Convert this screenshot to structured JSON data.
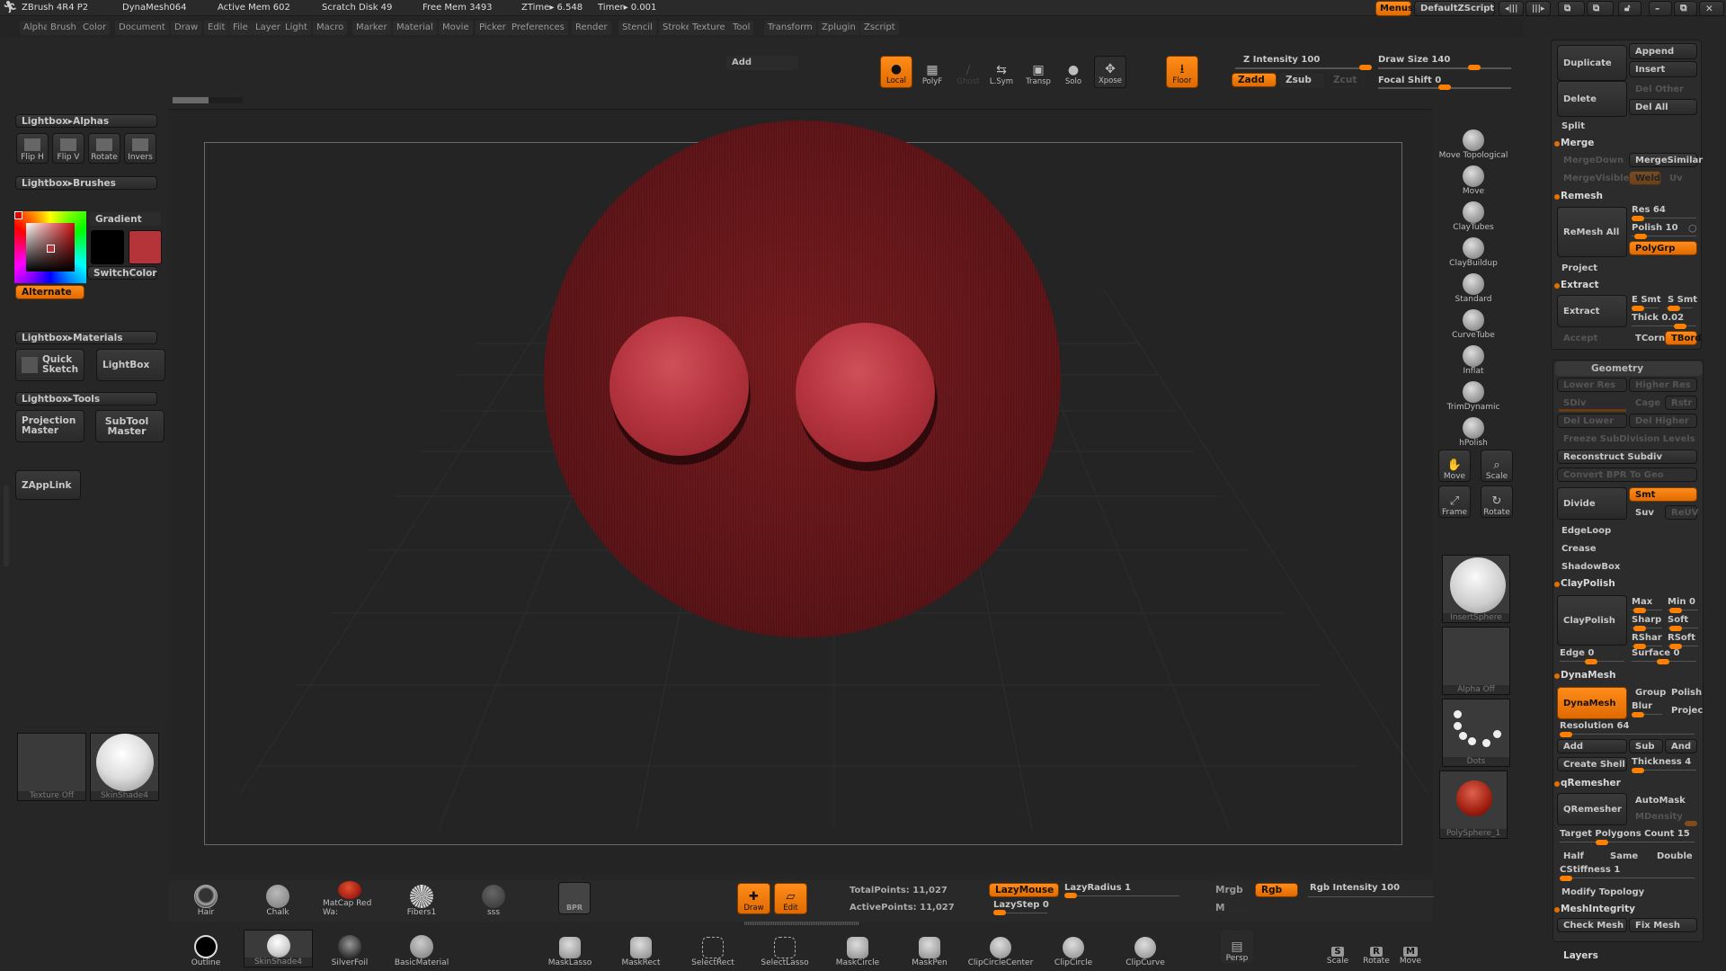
{
  "titlebar": {
    "app": "ZBrush 4R4 P2",
    "document": "DynaMesh064",
    "active_mem": "Active Mem 602",
    "scratch_disk": "Scratch Disk 49",
    "free_mem": "Free Mem 3493",
    "ztime": "ZTime▸ 6.548",
    "timer": "Timer▸ 0.001",
    "menus_button": "Menus",
    "script_button": "DefaultZScript"
  },
  "menubar": [
    "Alpha",
    "Brush",
    "Color",
    "Document",
    "Draw",
    "Edit",
    "File",
    "Layer",
    "Light",
    "Macro",
    "Marker",
    "Material",
    "Movie",
    "Picker",
    "Preferences",
    "Render",
    "Stencil",
    "Stroke",
    "Texture",
    "Tool",
    "Transform",
    "Zplugin",
    "Zscript"
  ],
  "top_toolbar": {
    "mode_field": "Add",
    "buttons": [
      {
        "id": "local",
        "label": "Local",
        "active": true
      },
      {
        "id": "polyf",
        "label": "PolyF",
        "active": false
      },
      {
        "id": "ghost",
        "label": "Ghost",
        "active": false,
        "disabled": true
      },
      {
        "id": "lsym",
        "label": "L.Sym",
        "active": false
      },
      {
        "id": "transp",
        "label": "Transp",
        "active": false
      },
      {
        "id": "solo",
        "label": "Solo",
        "active": false
      },
      {
        "id": "xpose",
        "label": "Xpose",
        "active": false
      },
      {
        "id": "floor",
        "label": "Floor",
        "active": true
      }
    ],
    "z_intensity": {
      "label": "Z Intensity",
      "value": "100",
      "fraction": 1.0
    },
    "draw_size": {
      "label": "Draw Size",
      "value": "140",
      "fraction": 0.7
    },
    "focal_shift": {
      "label": "Focal Shift",
      "value": "0",
      "fraction": 0.5
    },
    "zadd": "Zadd",
    "zsub": "Zsub",
    "zcut": "Zcut"
  },
  "left_panel": {
    "lightbox_alphas": "Lightbox▸Alphas",
    "alpha_buttons": [
      "Flip H",
      "Flip V",
      "Rotate",
      "Invers"
    ],
    "lightbox_brushes": "Lightbox▸Brushes",
    "gradient": "Gradient",
    "switch_color": "SwitchColor",
    "alternate": "Alternate",
    "main_color": "#b5343a",
    "secondary_color": "#000000",
    "lightbox_materials": "Lightbox▸Materials",
    "quick_sketch": "Quick Sketch",
    "lightbox": "LightBox",
    "lightbox_tools": "Lightbox▸Tools",
    "projection_master": "Projection Master",
    "subtool_master": "SubTool Master",
    "zapplink": "ZAppLink",
    "texture_thumb": "Texture Off",
    "material_thumb": "SkinShade4"
  },
  "right_shelf": {
    "brushes": [
      "Move Topological",
      "Move",
      "ClayTubes",
      "ClayBuildup",
      "Standard",
      "CurveTube",
      "Inflat",
      "TrimDynamic",
      "hPolish"
    ],
    "nav": [
      "Move",
      "Scale",
      "Frame",
      "Rotate"
    ],
    "thumbs": [
      "InsertSphere",
      "Alpha Off",
      "Dots",
      "PolySphere_1"
    ]
  },
  "tool_panel": {
    "duplicate": "Duplicate",
    "append": "Append",
    "insert": "Insert",
    "delete": "Delete",
    "del_other": "Del Other",
    "del_all": "Del All",
    "split": "Split",
    "merge": "Merge",
    "merge_down": "MergeDown",
    "merge_similar": "MergeSimilar",
    "merge_visible": "MergeVisible",
    "weld": "Weld",
    "uv": "Uv",
    "remesh": "Remesh",
    "remesh_all": "ReMesh All",
    "res": "Res 64",
    "polish": "Polish 10",
    "polygrp": "PolyGrp",
    "project": "Project",
    "extract": "Extract",
    "extract_btn": "Extract",
    "e_smt": "E Smt",
    "s_smt": "S Smt",
    "thick": "Thick 0.02",
    "accept": "Accept",
    "tcorn": "TCorn",
    "tbord": "TBord",
    "geometry": "Geometry",
    "lower_res": "Lower Res",
    "higher_res": "Higher Res",
    "sdiv": "SDiv",
    "cage": "Cage",
    "rstr": "Rstr",
    "del_lower": "Del Lower",
    "del_higher": "Del Higher",
    "freeze": "Freeze SubDivision Levels",
    "reconstruct": "Reconstruct Subdiv",
    "convert_bpr": "Convert BPR To Geo",
    "divide": "Divide",
    "smt": "Smt",
    "suv": "Suv",
    "reuv": "ReUV",
    "edgeloop": "EdgeLoop",
    "crease": "Crease",
    "shadowbox": "ShadowBox",
    "claypolish": "ClayPolish",
    "claypolish_btn": "ClayPolish",
    "max": "Max",
    "min": "Min 0",
    "sharp": "Sharp",
    "soft": "Soft",
    "rshar": "RShar",
    "rsoft": "RSoft",
    "edge": "Edge 0",
    "surface": "Surface 0",
    "dynamesh": "DynaMesh",
    "dynamesh_btn": "DynaMesh",
    "group": "Group",
    "polish2": "Polish",
    "blur": "Blur",
    "project2": "Projec",
    "resolution": "Resolution 64",
    "add": "Add",
    "sub": "Sub",
    "and": "And",
    "create_shell": "Create Shell",
    "thickness": "Thickness 4",
    "qremesher": "qRemesher",
    "qremesher_btn": "QRemesher",
    "automask": "AutoMask",
    "mdensity": "MDensity",
    "target_polys": "Target Polygons Count 15",
    "half": "Half",
    "same": "Same",
    "double": "Double",
    "cstiffness": "CStiffness 1",
    "modify_topology": "Modify Topology",
    "meshintegrity": "MeshIntegrity",
    "check_mesh": "Check Mesh",
    "fix_mesh": "Fix Mesh",
    "layers": "Layers"
  },
  "bottom_bar": {
    "materials_row1": [
      "Hair",
      "Chalk",
      "MatCap Red Wa:",
      "Fibers1",
      "sss"
    ],
    "bpr": "BPR",
    "draw": "Draw",
    "edit": "Edit",
    "total_points": "TotalPoints: 11,027",
    "active_points": "ActivePoints: 11,027",
    "lazymouse": "LazyMouse",
    "lazyradius": "LazyRadius 1",
    "lazystep": "LazyStep 0",
    "mrgb": "Mrgb",
    "rgb": "Rgb",
    "m": "M",
    "rgb_intensity": "Rgb Intensity 100",
    "materials_row2": [
      "Outline",
      "SkinShade4",
      "SilverFoil",
      "BasicMaterial"
    ],
    "tools_row2": [
      "MaskLasso",
      "MaskRect",
      "SelectRect",
      "SelectLasso",
      "MaskCircle",
      "MaskPen",
      "ClipCircleCenter",
      "ClipCircle",
      "ClipCurve"
    ],
    "persp": "Persp",
    "transform": [
      "Scale",
      "Rotate",
      "Move"
    ]
  }
}
